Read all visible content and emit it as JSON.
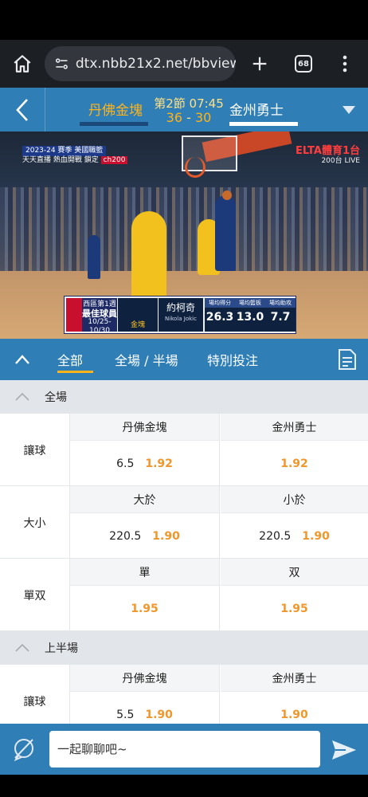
{
  "browser": {
    "url": "dtx.nbb21x2.net/bbview/",
    "tab_count": "68"
  },
  "match": {
    "home_team": "丹佛金塊",
    "away_team": "金州勇士",
    "period_time": "第2節 07:45",
    "home_score": "36",
    "score_sep": " - ",
    "away_score": "30"
  },
  "video": {
    "season_line1": "2023-24 賽季 美國職籃",
    "season_line2": "天天直播 熱血開戰 鎖定",
    "channel_code": "ch200",
    "broadcaster": "ELTA體育1台",
    "broadcaster_sub": "200台 LIVE",
    "award_line1": "西區第1週",
    "award_line2": "最佳球員",
    "award_line3": "10/25-10/30",
    "team_short": "金塊",
    "player_name": "約柯奇",
    "player_name_en": "Nikola Jokic",
    "stats": [
      {
        "label": "場均得分",
        "value": "26.3"
      },
      {
        "label": "場均籃板",
        "value": "13.0"
      },
      {
        "label": "場均助攻",
        "value": "7.7"
      }
    ]
  },
  "tabs": {
    "all": "全部",
    "full_half": "全場 / 半場",
    "special": "特別投注"
  },
  "sections": {
    "full": {
      "title": "全場",
      "spread": {
        "label": "讓球",
        "left_head": "丹佛金塊",
        "right_head": "金州勇士",
        "left_line": "6.5",
        "left_price": "1.92",
        "right_price": "1.92"
      },
      "total": {
        "label": "大小",
        "left_head": "大於",
        "right_head": "小於",
        "left_line": "220.5",
        "left_price": "1.90",
        "right_line": "220.5",
        "right_price": "1.90"
      },
      "odd_even": {
        "label": "單双",
        "left_head": "單",
        "right_head": "双",
        "left_price": "1.95",
        "right_price": "1.95"
      }
    },
    "first_half": {
      "title": "上半場",
      "spread": {
        "label": "讓球",
        "left_head": "丹佛金塊",
        "right_head": "金州勇士",
        "left_line": "5.5",
        "left_price": "1.90",
        "right_price": "1.90"
      }
    }
  },
  "chat": {
    "placeholder": "一起聊聊吧~"
  },
  "colors": {
    "header_blue": "#2f7fb6",
    "accent_orange": "#f0962a",
    "home_team_gold": "#ffb31a"
  }
}
